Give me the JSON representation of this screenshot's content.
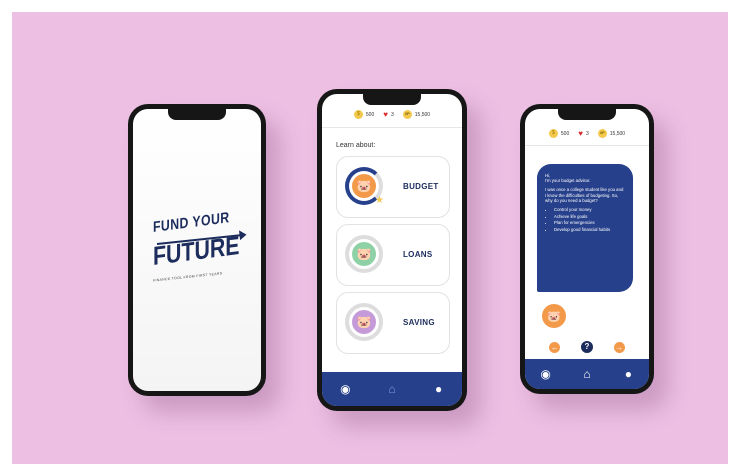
{
  "phones": {
    "splash": {
      "logo_line1": "FUND YOUR",
      "logo_line2": "FUTURE",
      "tagline": "FINANCE TOOL FROM FIRST YEARS"
    },
    "topics_screen": {
      "stats": {
        "coins": "500",
        "hearts": "3",
        "xp": "15,500"
      },
      "heading": "Learn about:",
      "topics": [
        {
          "label": "BUDGET",
          "color": "#f39a4a",
          "icon": "piggy-bank-icon"
        },
        {
          "label": "LOANS",
          "color": "#8fd1a6",
          "icon": "piggy-bank-icon"
        },
        {
          "label": "SAVING",
          "color": "#c59ad9",
          "icon": "piggy-bank-icon"
        }
      ],
      "nav": [
        "compass-icon",
        "home-icon",
        "profile-icon"
      ]
    },
    "advisor_screen": {
      "stats": {
        "coins": "500",
        "hearts": "3",
        "xp": "15,500"
      },
      "greeting": "Hi,",
      "intro": "I'm your budget advisor.",
      "story": "I was once a college student like you and I know the difficulties of budgeting. So, why do you need a budget?",
      "reasons": [
        "Control your money",
        "Achieve life goals",
        "Plan for emergencies",
        "Develop good financial habits"
      ],
      "controls": {
        "prev": "←",
        "help": "?",
        "next": "→"
      }
    }
  },
  "colors": {
    "background": "#edbfe3",
    "primary": "#26408b",
    "accent": "#f39a4a",
    "navy": "#1c2c5c"
  }
}
